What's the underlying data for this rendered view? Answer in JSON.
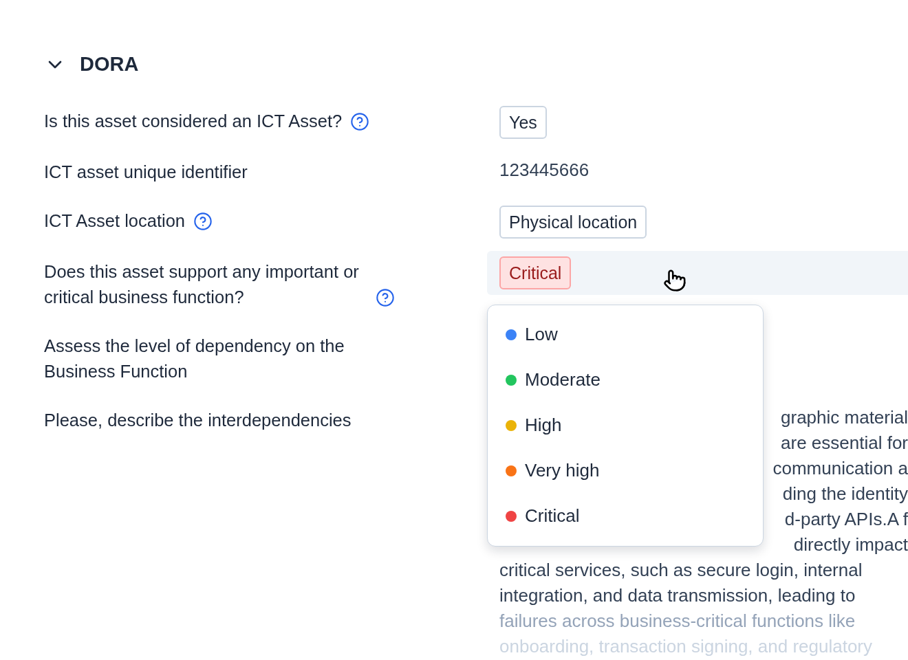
{
  "section": {
    "title": "DORA",
    "expanded": true
  },
  "fields": [
    {
      "label": "Is this asset considered an ICT Asset?",
      "help": true,
      "hovered": false,
      "kind": "chip",
      "value": "Yes"
    },
    {
      "label": "ICT asset unique identifier",
      "help": false,
      "hovered": false,
      "kind": "text",
      "value": "123445666"
    },
    {
      "label": "ICT Asset location",
      "help": true,
      "hovered": false,
      "kind": "chip",
      "value": "Physical location"
    },
    {
      "label": "Does this asset support any important or critical business function?",
      "help": true,
      "hovered": true,
      "kind": "badge",
      "value": "Critical",
      "dropdown": {
        "open": true,
        "options": [
          {
            "label": "Low",
            "color": "#3b82f6"
          },
          {
            "label": "Moderate",
            "color": "#22c55e"
          },
          {
            "label": "High",
            "color": "#eab308"
          },
          {
            "label": "Very high",
            "color": "#f97316"
          },
          {
            "label": "Critical",
            "color": "#ef4444"
          }
        ]
      }
    },
    {
      "label": "Assess the level of dependency on the Business Function",
      "help": false,
      "hovered": false,
      "kind": "empty"
    },
    {
      "label": "Please, describe the interdependencies",
      "help": false,
      "hovered": false,
      "kind": "paragraph",
      "lines": [
        {
          "text": "graphic material",
          "covered": true,
          "kind": "normal"
        },
        {
          "text": "are essential for",
          "covered": true,
          "kind": "normal"
        },
        {
          "text": "communication a",
          "covered": true,
          "kind": "normal"
        },
        {
          "text": "ding the identity",
          "covered": true,
          "kind": "normal"
        },
        {
          "text": "d-party APIs.A f",
          "covered": true,
          "kind": "normal"
        },
        {
          "text": "directly impact",
          "covered": true,
          "kind": "normal"
        },
        {
          "text": "critical services, such as secure login, internal",
          "covered": false,
          "kind": "normal"
        },
        {
          "text": "integration, and data transmission, leading to",
          "covered": false,
          "kind": "normal"
        },
        {
          "text": "failures across business-critical functions like",
          "covered": false,
          "kind": "muted"
        },
        {
          "text": "onboarding, transaction signing, and regulatory",
          "covered": false,
          "kind": "faint"
        }
      ]
    }
  ]
}
